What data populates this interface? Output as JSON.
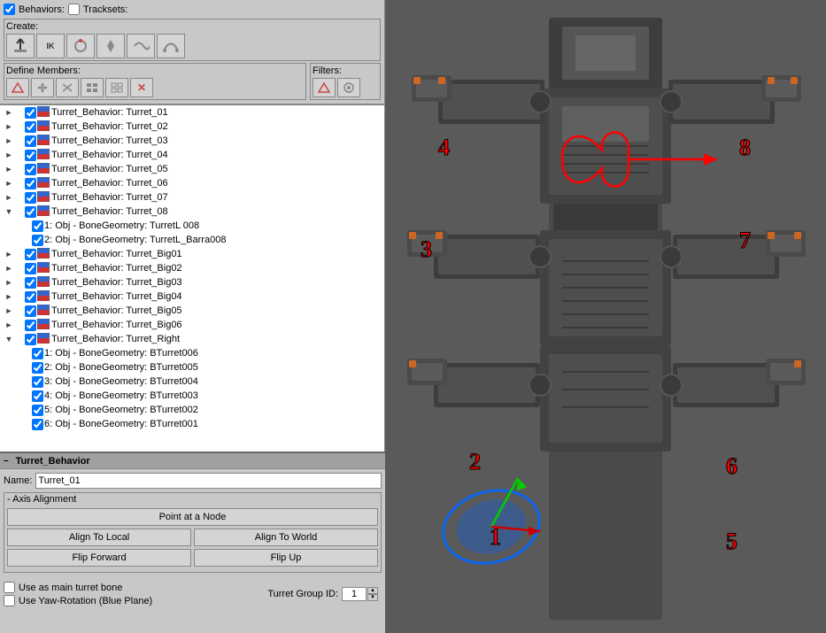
{
  "behaviors_row": {
    "label1": "Behaviors:",
    "label2": "Tracksets:"
  },
  "create": {
    "label": "Create:",
    "buttons": [
      "run-icon",
      "ik-icon",
      "circular-icon",
      "bone-icon",
      "motion-icon",
      "curve-icon"
    ]
  },
  "define_members": {
    "label": "Define Members:",
    "buttons": [
      "arrow-icon",
      "cross-arrow-icon",
      "cut-icon",
      "grid-icon",
      "grid2-icon",
      "x-icon"
    ]
  },
  "filters": {
    "label": "Filters:",
    "buttons": [
      "filter1-icon",
      "filter2-icon"
    ]
  },
  "tree_items": [
    {
      "id": "t01",
      "label": "Turret_Behavior: Turret_01",
      "level": 0,
      "expanded": false,
      "checked": true
    },
    {
      "id": "t02",
      "label": "Turret_Behavior: Turret_02",
      "level": 0,
      "expanded": false,
      "checked": true
    },
    {
      "id": "t03",
      "label": "Turret_Behavior: Turret_03",
      "level": 0,
      "expanded": false,
      "checked": true
    },
    {
      "id": "t04",
      "label": "Turret_Behavior: Turret_04",
      "level": 0,
      "expanded": false,
      "checked": true
    },
    {
      "id": "t05",
      "label": "Turret_Behavior: Turret_05",
      "level": 0,
      "expanded": false,
      "checked": true
    },
    {
      "id": "t06",
      "label": "Turret_Behavior: Turret_06",
      "level": 0,
      "expanded": false,
      "checked": true
    },
    {
      "id": "t07",
      "label": "Turret_Behavior: Turret_07",
      "level": 0,
      "expanded": false,
      "checked": true
    },
    {
      "id": "t08",
      "label": "Turret_Behavior: Turret_08",
      "level": 0,
      "expanded": true,
      "checked": true
    },
    {
      "id": "t08c1",
      "label": "1: Obj - BoneGeometry: TurretL 008",
      "level": 1,
      "expanded": false,
      "checked": true
    },
    {
      "id": "t08c2",
      "label": "2: Obj - BoneGeometry: TurretL_Barra008",
      "level": 1,
      "expanded": false,
      "checked": true
    },
    {
      "id": "tbig01",
      "label": "Turret_Behavior: Turret_Big01",
      "level": 0,
      "expanded": false,
      "checked": true
    },
    {
      "id": "tbig02",
      "label": "Turret_Behavior: Turret_Big02",
      "level": 0,
      "expanded": false,
      "checked": true
    },
    {
      "id": "tbig03",
      "label": "Turret_Behavior: Turret_Big03",
      "level": 0,
      "expanded": false,
      "checked": true
    },
    {
      "id": "tbig04",
      "label": "Turret_Behavior: Turret_Big04",
      "level": 0,
      "expanded": false,
      "checked": true
    },
    {
      "id": "tbig05",
      "label": "Turret_Behavior: Turret_Big05",
      "level": 0,
      "expanded": false,
      "checked": true
    },
    {
      "id": "tbig06",
      "label": "Turret_Behavior: Turret_Big06",
      "level": 0,
      "expanded": false,
      "checked": true
    },
    {
      "id": "tright",
      "label": "Turret_Behavior: Turret_Right",
      "level": 0,
      "expanded": true,
      "checked": true
    },
    {
      "id": "trc1",
      "label": "1: Obj - BoneGeometry: BTurret006",
      "level": 1,
      "expanded": false,
      "checked": true
    },
    {
      "id": "trc2",
      "label": "2: Obj - BoneGeometry: BTurret005",
      "level": 1,
      "expanded": false,
      "checked": true
    },
    {
      "id": "trc3",
      "label": "3: Obj - BoneGeometry: BTurret004",
      "level": 1,
      "expanded": false,
      "checked": true
    },
    {
      "id": "trc4",
      "label": "4: Obj - BoneGeometry: BTurret003",
      "level": 1,
      "expanded": false,
      "checked": true
    },
    {
      "id": "trc5",
      "label": "5: Obj - BoneGeometry: BTurret002",
      "level": 1,
      "expanded": false,
      "checked": true
    },
    {
      "id": "trc6",
      "label": "6: Obj - BoneGeometry: BTurret001",
      "level": 1,
      "expanded": false,
      "checked": true
    }
  ],
  "bottom_panel": {
    "title": "Turret_Behavior",
    "name_label": "Name:",
    "name_value": "Turret_01",
    "axis_label": "- Axis Alignment",
    "point_node_btn": "Point at a Node",
    "align_local_btn": "Align To Local",
    "align_world_btn": "Align To World",
    "flip_forward_btn": "Flip Forward",
    "flip_up_btn": "Flip Up",
    "use_main_bone_label": "Use as main turret bone",
    "use_yaw_label": "Use Yaw-Rotation (Blue Plane)",
    "turret_group_label": "Turret Group ID:",
    "turret_group_value": "1"
  },
  "numbers": [
    "1",
    "2",
    "3",
    "4",
    "5",
    "6",
    "7",
    "8"
  ],
  "minus_btn": "-"
}
